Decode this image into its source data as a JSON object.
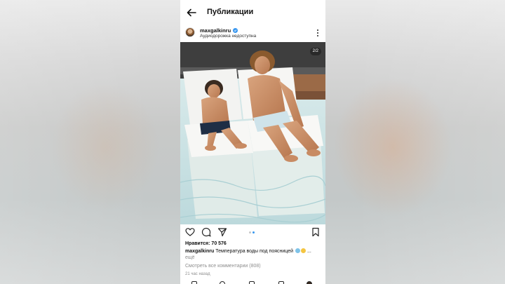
{
  "header": {
    "title": "Публикации",
    "back_icon": "arrow-left-icon"
  },
  "post": {
    "username": "maxgalkinru",
    "verified_icon": "verified-badge-icon",
    "audio_note": "Аудиодорожка недоступна",
    "more_icon": "more-vertical-icon",
    "photo_counter": "2/2",
    "carousel": {
      "count": 2,
      "active_index": 1
    },
    "actions": [
      "heart-icon",
      "comment-icon",
      "share-icon",
      "bookmark-icon"
    ],
    "likes": "Нравится: 70 576",
    "caption_user": "maxgalkinru",
    "caption_text": "Температура воды под поясницей",
    "caption_ellipsis": "...",
    "more_label": "ещё",
    "comments_link": "Смотреть все комментарии (808)",
    "time_ago": "21 час назад"
  },
  "bottom_nav": [
    "home-icon",
    "search-icon",
    "reels-icon",
    "shop-icon",
    "profile-icon"
  ],
  "colors": {
    "accent": "#3897f0",
    "muted": "#8e8e8e",
    "text": "#111111"
  }
}
